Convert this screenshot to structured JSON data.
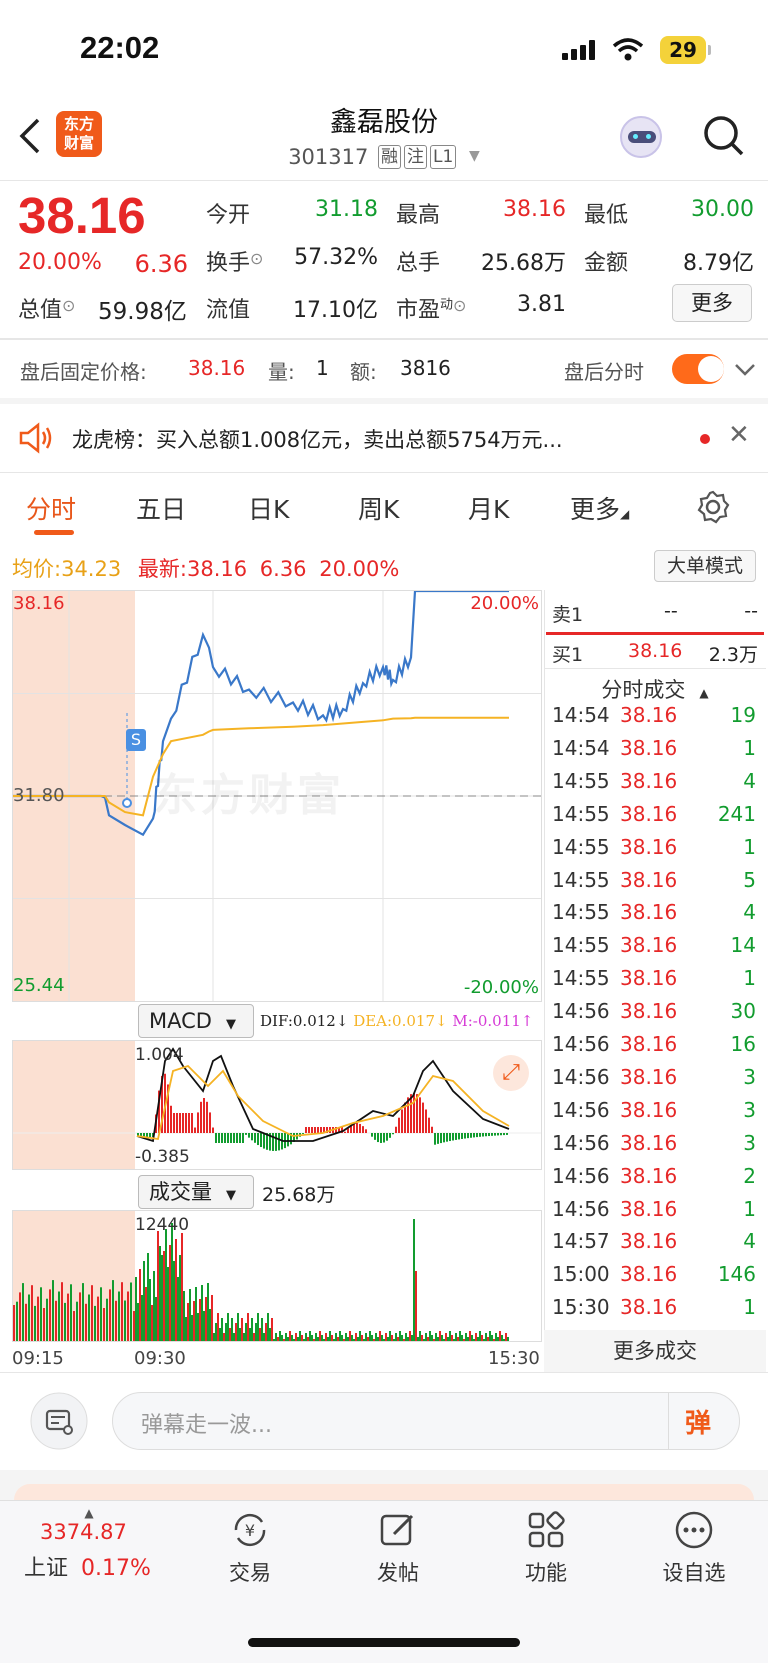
{
  "status": {
    "time": "22:02",
    "battery": "29"
  },
  "header": {
    "logo": "东方财富",
    "name": "鑫磊股份",
    "code": "301317",
    "tags": [
      "融",
      "注",
      "L1"
    ]
  },
  "quote": {
    "price": "38.16",
    "pct": "20.00%",
    "chg": "6.36",
    "rows": [
      [
        {
          "l": "今开",
          "v": "31.18",
          "c": "green"
        },
        {
          "l": "最高",
          "v": "38.16",
          "c": "red"
        },
        {
          "l": "最低",
          "v": "30.00",
          "c": "green"
        }
      ],
      [
        {
          "l": "换手",
          "v": "57.32%",
          "c": "dark"
        },
        {
          "l": "总手",
          "v": "25.68万",
          "c": "dark"
        },
        {
          "l": "金额",
          "v": "8.79亿",
          "c": "dark"
        }
      ],
      [
        {
          "l": "流值",
          "v": "17.10亿",
          "c": "dark"
        },
        {
          "l": "市盈",
          "v": "3.81",
          "c": "dark"
        }
      ]
    ],
    "total_label": "总值",
    "total_value": "59.98亿",
    "pe_sup": "动",
    "more": "更多"
  },
  "afterhours": {
    "label": "盘后固定价格:",
    "price": "38.16",
    "vol_label": "量:",
    "vol": "1",
    "amt_label": "额:",
    "amt": "3816",
    "fen_label": "盘后分时"
  },
  "banner": {
    "text": "龙虎榜：买入总额1.008亿元，卖出总额5754万元..."
  },
  "tabs": [
    "分时",
    "五日",
    "日K",
    "周K",
    "月K",
    "更多"
  ],
  "info": {
    "avg_label": "均价:",
    "avg": "34.23",
    "last_label": "最新:",
    "last": "38.16",
    "chg": "6.36",
    "pct": "20.00%",
    "mode_btn": "大单模式"
  },
  "chart": {
    "ymax": "38.16",
    "ymin": "25.44",
    "pmax": "20.00%",
    "pmin": "-20.00%",
    "mid": "31.80",
    "watermark": "东方财富",
    "marker": "S",
    "macd_sel": "MACD",
    "dif": "DIF:0.012",
    "dea": "DEA:0.017",
    "m": "M:-0.011",
    "macd_hi": "1.004",
    "macd_lo": "-0.385",
    "vol_sel": "成交量",
    "vol_total": "25.68万",
    "vol_max": "12440",
    "t0": "09:15",
    "t1": "09:30",
    "t2": "15:30"
  },
  "chart_data": [
    {
      "type": "line",
      "title": "分时",
      "series": [
        {
          "name": "price",
          "values": [
            31.8,
            31.8,
            31.75,
            31.2,
            30.9,
            30.6,
            31.1,
            33.5,
            34.2,
            36.8,
            36.4,
            35.8,
            35.1,
            34.7,
            34.3,
            34.5,
            35.3,
            35.8,
            35.4,
            36.1,
            38.16,
            38.16
          ]
        },
        {
          "name": "avg",
          "values": [
            31.8,
            31.8,
            31.8,
            31.6,
            31.3,
            31.2,
            32.4,
            33.1,
            33.5,
            33.7,
            33.8,
            33.85,
            33.9,
            33.95,
            34.0,
            34.05,
            34.1,
            34.15,
            34.2,
            34.21,
            34.23,
            34.23
          ]
        }
      ],
      "ylim": [
        25.44,
        38.16
      ]
    },
    {
      "type": "bar",
      "title": "成交量",
      "ylim": [
        0,
        12440
      ]
    }
  ],
  "trades": {
    "sell1_label": "卖1",
    "sell1_p": "--",
    "sell1_v": "--",
    "buy1_label": "买1",
    "buy1_p": "38.16",
    "buy1_v": "2.3万",
    "header": "分时成交",
    "more": "更多成交",
    "rows": [
      [
        "14:54",
        "38.16",
        "19"
      ],
      [
        "14:54",
        "38.16",
        "1"
      ],
      [
        "14:55",
        "38.16",
        "4"
      ],
      [
        "14:55",
        "38.16",
        "241"
      ],
      [
        "14:55",
        "38.16",
        "1"
      ],
      [
        "14:55",
        "38.16",
        "5"
      ],
      [
        "14:55",
        "38.16",
        "4"
      ],
      [
        "14:55",
        "38.16",
        "14"
      ],
      [
        "14:55",
        "38.16",
        "1"
      ],
      [
        "14:56",
        "38.16",
        "30"
      ],
      [
        "14:56",
        "38.16",
        "16"
      ],
      [
        "14:56",
        "38.16",
        "3"
      ],
      [
        "14:56",
        "38.16",
        "3"
      ],
      [
        "14:56",
        "38.16",
        "3"
      ],
      [
        "14:56",
        "38.16",
        "2"
      ],
      [
        "14:56",
        "38.16",
        "1"
      ],
      [
        "14:57",
        "38.16",
        "4"
      ],
      [
        "15:00",
        "38.16",
        "146"
      ],
      [
        "15:30",
        "38.16",
        "1"
      ]
    ]
  },
  "comment": {
    "placeholder": "弹幕走一波...",
    "btn": "弹"
  },
  "bottom": {
    "index_val": "3374.87",
    "index_name": "上证",
    "index_pct": "0.17%",
    "items": [
      "交易",
      "发帖",
      "功能",
      "设自选"
    ]
  }
}
